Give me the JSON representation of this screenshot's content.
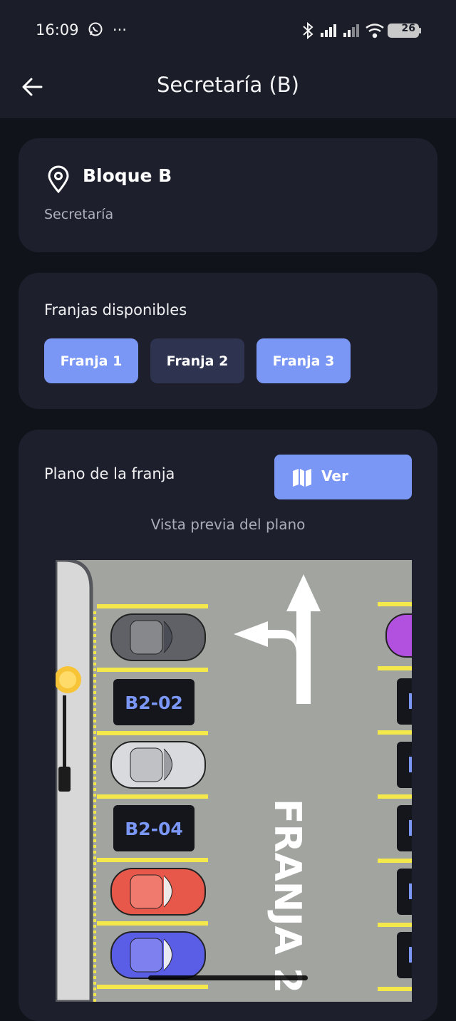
{
  "status_bar": {
    "time": "16:09",
    "battery": "26"
  },
  "app_bar": {
    "title": "Secretaría (B)"
  },
  "location": {
    "title": "Bloque B",
    "subtitle": "Secretaría"
  },
  "franjas": {
    "title": "Franjas disponibles",
    "chips": [
      {
        "label": "Franja 1",
        "selected": true
      },
      {
        "label": "Franja 2",
        "selected": false
      },
      {
        "label": "Franja 3",
        "selected": true
      }
    ]
  },
  "plano": {
    "title": "Plano de la franja",
    "button_label": "Ver",
    "preview_label": "Vista previa del plano",
    "map": {
      "lane_label": "FRANJA 2",
      "spot_labels": [
        "B2-02",
        "B2-04"
      ],
      "car_colors": [
        "#5f6166",
        "#d9dade",
        "#e8584a",
        "#5a5ee6"
      ]
    }
  },
  "colors": {
    "accent": "#7b97f5",
    "card": "#1d202c",
    "background": "#11131b"
  }
}
